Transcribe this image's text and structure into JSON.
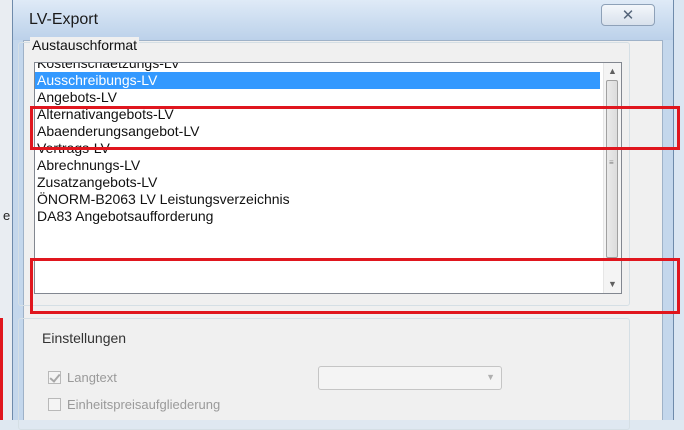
{
  "background": {
    "left_letter": "e"
  },
  "dialog": {
    "title": "LV-Export",
    "close_glyph": "✕"
  },
  "format_group": {
    "label": "Austauschformat",
    "items": [
      {
        "label": "Kostenschaetzungs-LV",
        "selected": false
      },
      {
        "label": "Ausschreibungs-LV",
        "selected": true
      },
      {
        "label": "Angebots-LV",
        "selected": false
      },
      {
        "label": "Alternativangebots-LV",
        "selected": false
      },
      {
        "label": "Abaenderungsangebot-LV",
        "selected": false
      },
      {
        "label": "Vertrags-LV",
        "selected": false
      },
      {
        "label": "Abrechnungs-LV",
        "selected": false
      },
      {
        "label": "Zusatzangebots-LV",
        "selected": false
      },
      {
        "label": "ÖNORM-B2063 LV Leistungsverzeichnis",
        "selected": false
      },
      {
        "label": "DA83 Angebotsaufforderung",
        "selected": false
      }
    ],
    "scroll_up": "▲",
    "scroll_down": "▼"
  },
  "settings_group": {
    "label": "Einstellungen",
    "langtext": {
      "label": "Langtext",
      "checked": true
    },
    "einheitspreis": {
      "label": "Einheitspreisaufgliederung",
      "checked": false
    },
    "combo_value": "",
    "combo_arrow": "▼"
  },
  "colors": {
    "highlight_red": "#e0161e",
    "selection_blue": "#3399ff"
  }
}
